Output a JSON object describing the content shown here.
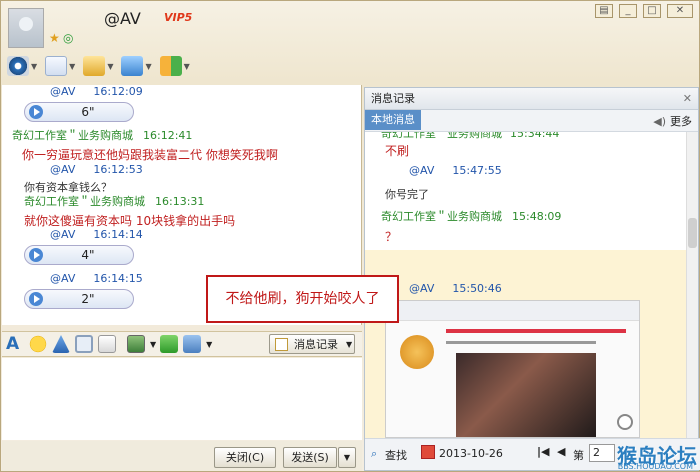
{
  "header": {
    "nickname": "@AV",
    "vip_badge": "VIP5"
  },
  "toolbar": {
    "icons": [
      "webcam-icon",
      "microphone-icon",
      "file-transfer-icon",
      "remote-desktop-icon",
      "apps-icon"
    ]
  },
  "chat": {
    "messages": [
      {
        "name": "@AV",
        "time": "16:12:09",
        "voice": "6\"",
        "color": "blue"
      },
      {
        "name": "奇幻工作室＂业务购商城",
        "time": "16:12:41",
        "text": "你一穷逼玩意还他妈跟我装富二代  你想笑死我啊",
        "color": "green"
      },
      {
        "name": "@AV",
        "time": "16:12:53",
        "text": "你有资本拿钱么？",
        "color": "blue"
      },
      {
        "name": "奇幻工作室＂业务购商城",
        "time": "16:13:31",
        "text": "就你这傻逼有资本吗   10块钱拿的出手吗",
        "color": "green"
      },
      {
        "name": "@AV",
        "time": "16:14:14",
        "voice": "4\"",
        "color": "blue"
      },
      {
        "name": "@AV",
        "time": "16:14:15",
        "voice": "2\"",
        "color": "blue"
      }
    ]
  },
  "format_bar": {
    "history_button": "消息记录"
  },
  "buttons": {
    "close": "关闭(C)",
    "send": "发送(S)"
  },
  "history": {
    "title": "消息记录",
    "tab_local": "本地消息",
    "more": "更多",
    "entries": [
      {
        "name": "奇幻工作室＂业务购商城",
        "time": "15:34:44",
        "text": "不刷"
      },
      {
        "name": "@AV",
        "time": "15:47:55",
        "text": "你号完了"
      },
      {
        "name": "奇幻工作室＂业务购商城",
        "time": "15:48:09",
        "text": "？"
      },
      {
        "name": "@AV",
        "time": "15:50:46",
        "text": ""
      }
    ],
    "footer": {
      "search": "查找",
      "date": "2013-10-26",
      "page_label": "第",
      "page": "2"
    }
  },
  "annotation": "不给他刷，狗开始咬人了",
  "watermark": {
    "main": "猴岛论坛",
    "sub": "BBS.HOUDAO.COM"
  }
}
